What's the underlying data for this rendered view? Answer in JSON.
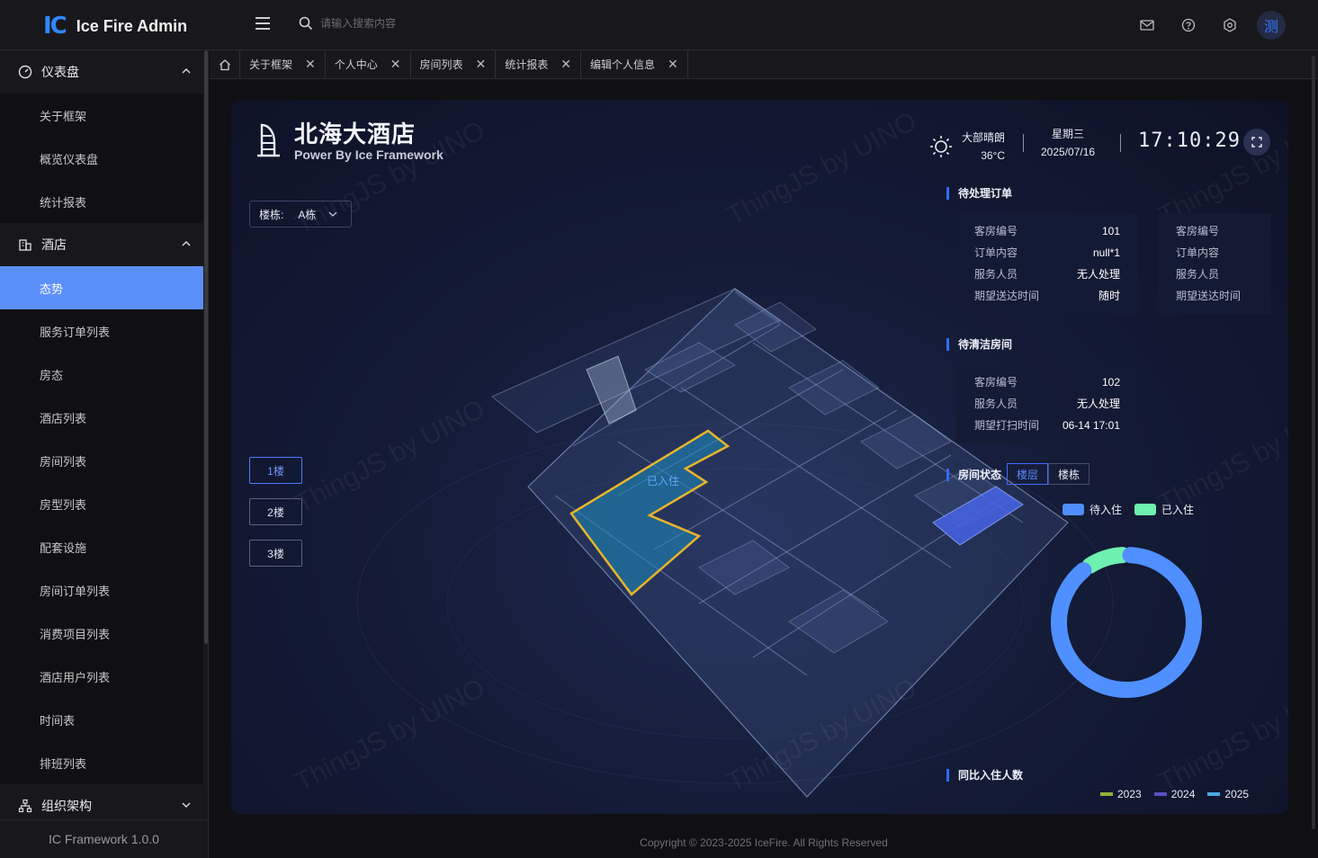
{
  "app": {
    "logo_mark": "IC",
    "title": "Ice Fire Admin"
  },
  "search": {
    "placeholder": "请输入搜索内容"
  },
  "user": {
    "avatar_text": "测"
  },
  "sidebar": {
    "groups": [
      {
        "label": "仪表盘",
        "items": [
          "关于框架",
          "概览仪表盘",
          "统计报表"
        ]
      },
      {
        "label": "酒店",
        "items": [
          "态势",
          "服务订单列表",
          "房态",
          "酒店列表",
          "房间列表",
          "房型列表",
          "配套设施",
          "房间订单列表",
          "消费项目列表",
          "酒店用户列表",
          "时间表",
          "排班列表"
        ]
      },
      {
        "label": "组织架构"
      }
    ],
    "active_item": "态势",
    "footer": "IC Framework 1.0.0"
  },
  "tabs": [
    "关于框架",
    "个人中心",
    "房间列表",
    "统计报表",
    "编辑个人信息"
  ],
  "dashboard": {
    "hotel_name": "北海大酒店",
    "subtitle": "Power By Ice Framework",
    "weather": {
      "desc": "大部晴朗",
      "temp": "36°C"
    },
    "weekday": "星期三",
    "date": "2025/07/16",
    "time": "17:10:29",
    "building_select": {
      "label": "楼栋:",
      "value": "A栋"
    },
    "floors": [
      "1楼",
      "2楼",
      "3楼"
    ],
    "active_floor": "1楼",
    "scene_label": "已入住",
    "pending_orders": {
      "title": "待处理订单",
      "cards": [
        [
          {
            "k": "客房编号",
            "v": "101"
          },
          {
            "k": "订单内容",
            "v": "null*1"
          },
          {
            "k": "服务人员",
            "v": "无人处理"
          },
          {
            "k": "期望送达时间",
            "v": "随时"
          }
        ],
        [
          {
            "k": "客房编号",
            "v": ""
          },
          {
            "k": "订单内容",
            "v": ""
          },
          {
            "k": "服务人员",
            "v": ""
          },
          {
            "k": "期望送达时间",
            "v": ""
          }
        ]
      ]
    },
    "pending_cleaning": {
      "title": "待清洁房间",
      "rows": [
        {
          "k": "客房编号",
          "v": "102"
        },
        {
          "k": "服务人员",
          "v": "无人处理"
        },
        {
          "k": "期望打扫时间",
          "v": "06-14 17:01"
        }
      ]
    },
    "room_status": {
      "title": "房间状态",
      "tabs": [
        "楼层",
        "楼栋"
      ],
      "active_tab": "楼层",
      "legend": [
        {
          "name": "待入住",
          "color": "#4f8fff"
        },
        {
          "name": "已入住",
          "color": "#6ef0b0"
        }
      ],
      "values": {
        "待入住": 9,
        "已入住": 1
      }
    },
    "checkin_compare": {
      "title": "同比入住人数",
      "legend": [
        {
          "name": "2023",
          "color": "#8fb23a"
        },
        {
          "name": "2024",
          "color": "#5d4fc9"
        },
        {
          "name": "2025",
          "color": "#4aa8e0"
        }
      ]
    },
    "watermark": "ThingJS by UINO"
  },
  "footer": {
    "copyright": "Copyright © 2023-2025 IceFire. All Rights Reserved"
  }
}
